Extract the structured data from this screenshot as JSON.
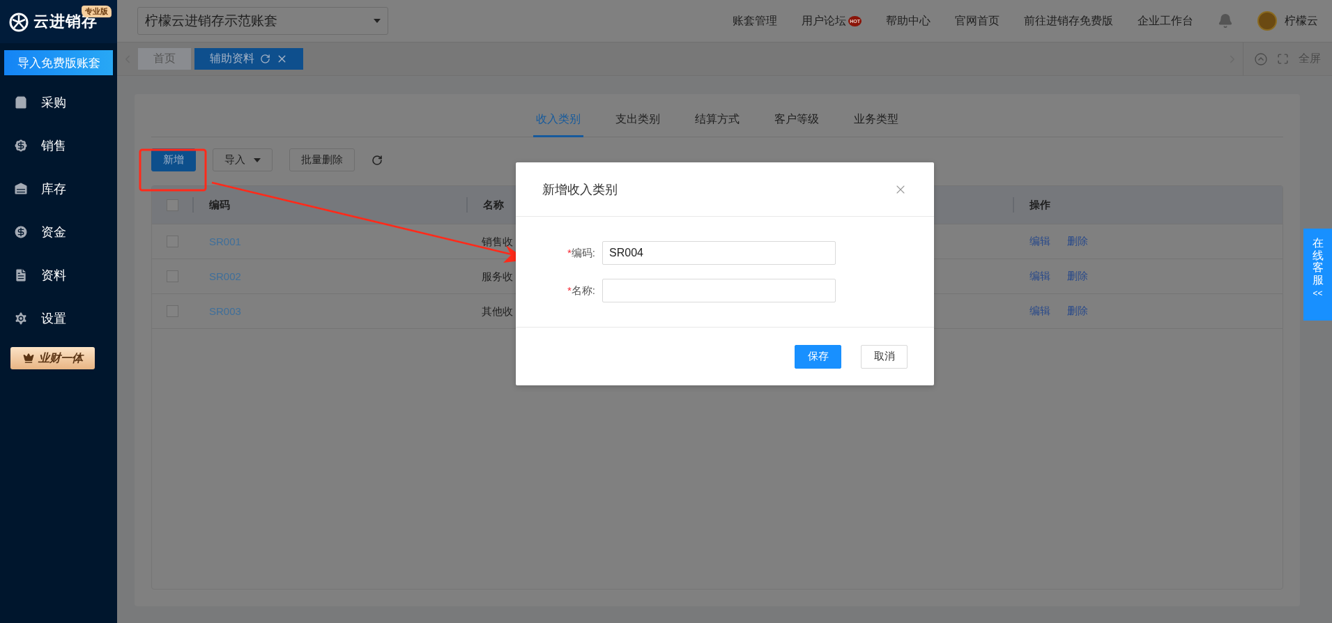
{
  "sidebar": {
    "logo": "云进销存",
    "edition": "专业版",
    "import_button": "导入免费版账套",
    "items": [
      {
        "label": "采购"
      },
      {
        "label": "销售"
      },
      {
        "label": "库存"
      },
      {
        "label": "资金"
      },
      {
        "label": "资料"
      },
      {
        "label": "设置"
      }
    ],
    "promo": "业财一体"
  },
  "topbar": {
    "account": "柠檬云进销存示范账套",
    "links": [
      {
        "label": "账套管理"
      },
      {
        "label": "用户论坛",
        "badge": "HOT"
      },
      {
        "label": "帮助中心"
      },
      {
        "label": "官网首页"
      },
      {
        "label": "前往进销存免费版"
      },
      {
        "label": "企业工作台"
      }
    ],
    "user": "柠檬云"
  },
  "page_tabs": [
    {
      "label": "首页",
      "selected": false
    },
    {
      "label": "辅助资料",
      "selected": true
    }
  ],
  "fullscreen": "全屏",
  "category_tabs": [
    {
      "label": "收入类别",
      "selected": true
    },
    {
      "label": "支出类别",
      "selected": false
    },
    {
      "label": "结算方式",
      "selected": false
    },
    {
      "label": "客户等级",
      "selected": false
    },
    {
      "label": "业务类型",
      "selected": false
    }
  ],
  "toolbar": {
    "add": "新增",
    "import": "导入",
    "batch_delete": "批量删除"
  },
  "table": {
    "header_checked": false,
    "columns": [
      "编码",
      "名称",
      "操作"
    ],
    "rows": [
      {
        "checked": false,
        "code": "SR001",
        "name": "销售收",
        "actions": [
          "编辑",
          "删除"
        ]
      },
      {
        "checked": false,
        "code": "SR002",
        "name": "服务收",
        "actions": [
          "编辑",
          "删除"
        ]
      },
      {
        "checked": false,
        "code": "SR003",
        "name": "其他收",
        "actions": [
          "编辑",
          "删除"
        ]
      }
    ]
  },
  "dialog": {
    "title": "新增收入类别",
    "fields": [
      {
        "required_mark": "*",
        "label": "编码:",
        "value": "SR004"
      },
      {
        "required_mark": "*",
        "label": "名称:"
      }
    ],
    "buttons": [
      {
        "label": "保存",
        "kind": "primary"
      },
      {
        "label": "取消",
        "kind": "default"
      }
    ]
  },
  "service_tab": {
    "label": "在线客服",
    "toggle": "<<"
  }
}
